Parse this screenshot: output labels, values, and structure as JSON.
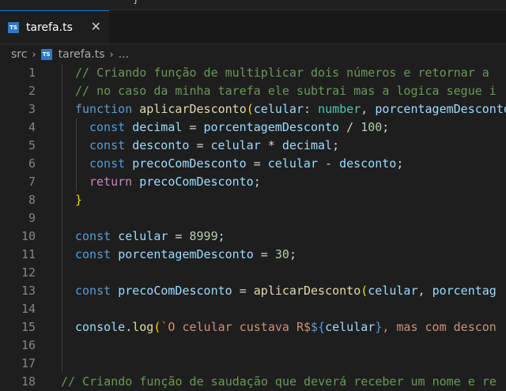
{
  "topbar": {
    "peek": "}"
  },
  "tab": {
    "icon_text": "TS",
    "label": "tarefa.ts",
    "close": "✕"
  },
  "breadcrumb": {
    "folder": "src",
    "file": "tarefa.ts",
    "rest": "...",
    "sep": "›"
  },
  "lines": [
    {
      "n": "1",
      "indent": 0,
      "tokens": [
        {
          "t": "// Criando função de multiplicar dois números e retornar a",
          "c": "comment"
        }
      ]
    },
    {
      "n": "2",
      "indent": 0,
      "tokens": [
        {
          "t": "// no caso da minha tarefa ele subtrai mas a logica segue i",
          "c": "comment"
        }
      ]
    },
    {
      "n": "3",
      "indent": 0,
      "tokens": [
        {
          "t": "function ",
          "c": "kw"
        },
        {
          "t": "aplicarDesconto",
          "c": "fn"
        },
        {
          "t": "(",
          "c": "brace"
        },
        {
          "t": "celular",
          "c": "var"
        },
        {
          "t": ": ",
          "c": "plain"
        },
        {
          "t": "number",
          "c": "type"
        },
        {
          "t": ", ",
          "c": "plain"
        },
        {
          "t": "porcentagemDesconto",
          "c": "var"
        }
      ]
    },
    {
      "n": "4",
      "indent": 1,
      "tokens": [
        {
          "t": "const ",
          "c": "kw"
        },
        {
          "t": "decimal",
          "c": "var"
        },
        {
          "t": " = ",
          "c": "plain"
        },
        {
          "t": "porcentagemDesconto",
          "c": "var"
        },
        {
          "t": " / ",
          "c": "plain"
        },
        {
          "t": "100",
          "c": "num"
        },
        {
          "t": ";",
          "c": "plain"
        }
      ]
    },
    {
      "n": "5",
      "indent": 1,
      "tokens": [
        {
          "t": "const ",
          "c": "kw"
        },
        {
          "t": "desconto",
          "c": "var"
        },
        {
          "t": " = ",
          "c": "plain"
        },
        {
          "t": "celular",
          "c": "var"
        },
        {
          "t": " * ",
          "c": "plain"
        },
        {
          "t": "decimal",
          "c": "var"
        },
        {
          "t": ";",
          "c": "plain"
        }
      ]
    },
    {
      "n": "6",
      "indent": 1,
      "tokens": [
        {
          "t": "const ",
          "c": "kw"
        },
        {
          "t": "precoComDesconto",
          "c": "var"
        },
        {
          "t": " = ",
          "c": "plain"
        },
        {
          "t": "celular",
          "c": "var"
        },
        {
          "t": " - ",
          "c": "plain"
        },
        {
          "t": "desconto",
          "c": "var"
        },
        {
          "t": ";",
          "c": "plain"
        }
      ]
    },
    {
      "n": "7",
      "indent": 1,
      "tokens": [
        {
          "t": "return ",
          "c": "ctrl"
        },
        {
          "t": "precoComDesconto",
          "c": "var"
        },
        {
          "t": ";",
          "c": "plain"
        }
      ]
    },
    {
      "n": "8",
      "indent": 0,
      "tokens": [
        {
          "t": "}",
          "c": "brace"
        }
      ]
    },
    {
      "n": "9",
      "indent": 0,
      "tokens": []
    },
    {
      "n": "10",
      "indent": 0,
      "tokens": [
        {
          "t": "const ",
          "c": "kw"
        },
        {
          "t": "celular",
          "c": "var"
        },
        {
          "t": " = ",
          "c": "plain"
        },
        {
          "t": "8999",
          "c": "num"
        },
        {
          "t": ";",
          "c": "plain"
        }
      ]
    },
    {
      "n": "11",
      "indent": 0,
      "tokens": [
        {
          "t": "const ",
          "c": "kw"
        },
        {
          "t": "porcentagemDesconto",
          "c": "var"
        },
        {
          "t": " = ",
          "c": "plain"
        },
        {
          "t": "30",
          "c": "num"
        },
        {
          "t": ";",
          "c": "plain"
        }
      ]
    },
    {
      "n": "12",
      "indent": 0,
      "tokens": []
    },
    {
      "n": "13",
      "indent": 0,
      "tokens": [
        {
          "t": "const ",
          "c": "kw"
        },
        {
          "t": "precoComDesconto",
          "c": "var"
        },
        {
          "t": " = ",
          "c": "plain"
        },
        {
          "t": "aplicarDesconto",
          "c": "fn"
        },
        {
          "t": "(",
          "c": "brace"
        },
        {
          "t": "celular",
          "c": "var"
        },
        {
          "t": ", ",
          "c": "plain"
        },
        {
          "t": "porcentag",
          "c": "var"
        }
      ]
    },
    {
      "n": "14",
      "indent": 0,
      "tokens": []
    },
    {
      "n": "15",
      "indent": 0,
      "tokens": [
        {
          "t": "console",
          "c": "var"
        },
        {
          "t": ".",
          "c": "plain"
        },
        {
          "t": "log",
          "c": "fn"
        },
        {
          "t": "(",
          "c": "brace"
        },
        {
          "t": "`O celular custava R$",
          "c": "str"
        },
        {
          "t": "${",
          "c": "kw"
        },
        {
          "t": "celular",
          "c": "var"
        },
        {
          "t": "}",
          "c": "kw"
        },
        {
          "t": ", mas com descon",
          "c": "str"
        }
      ]
    },
    {
      "n": "16",
      "indent": 0,
      "tokens": []
    },
    {
      "n": "17",
      "indent": 0,
      "tokens": []
    },
    {
      "n": "18",
      "indent": -1,
      "tokens": [
        {
          "t": "// Criando função de saudação que deverá receber um nome e re",
          "c": "comment"
        }
      ]
    }
  ]
}
